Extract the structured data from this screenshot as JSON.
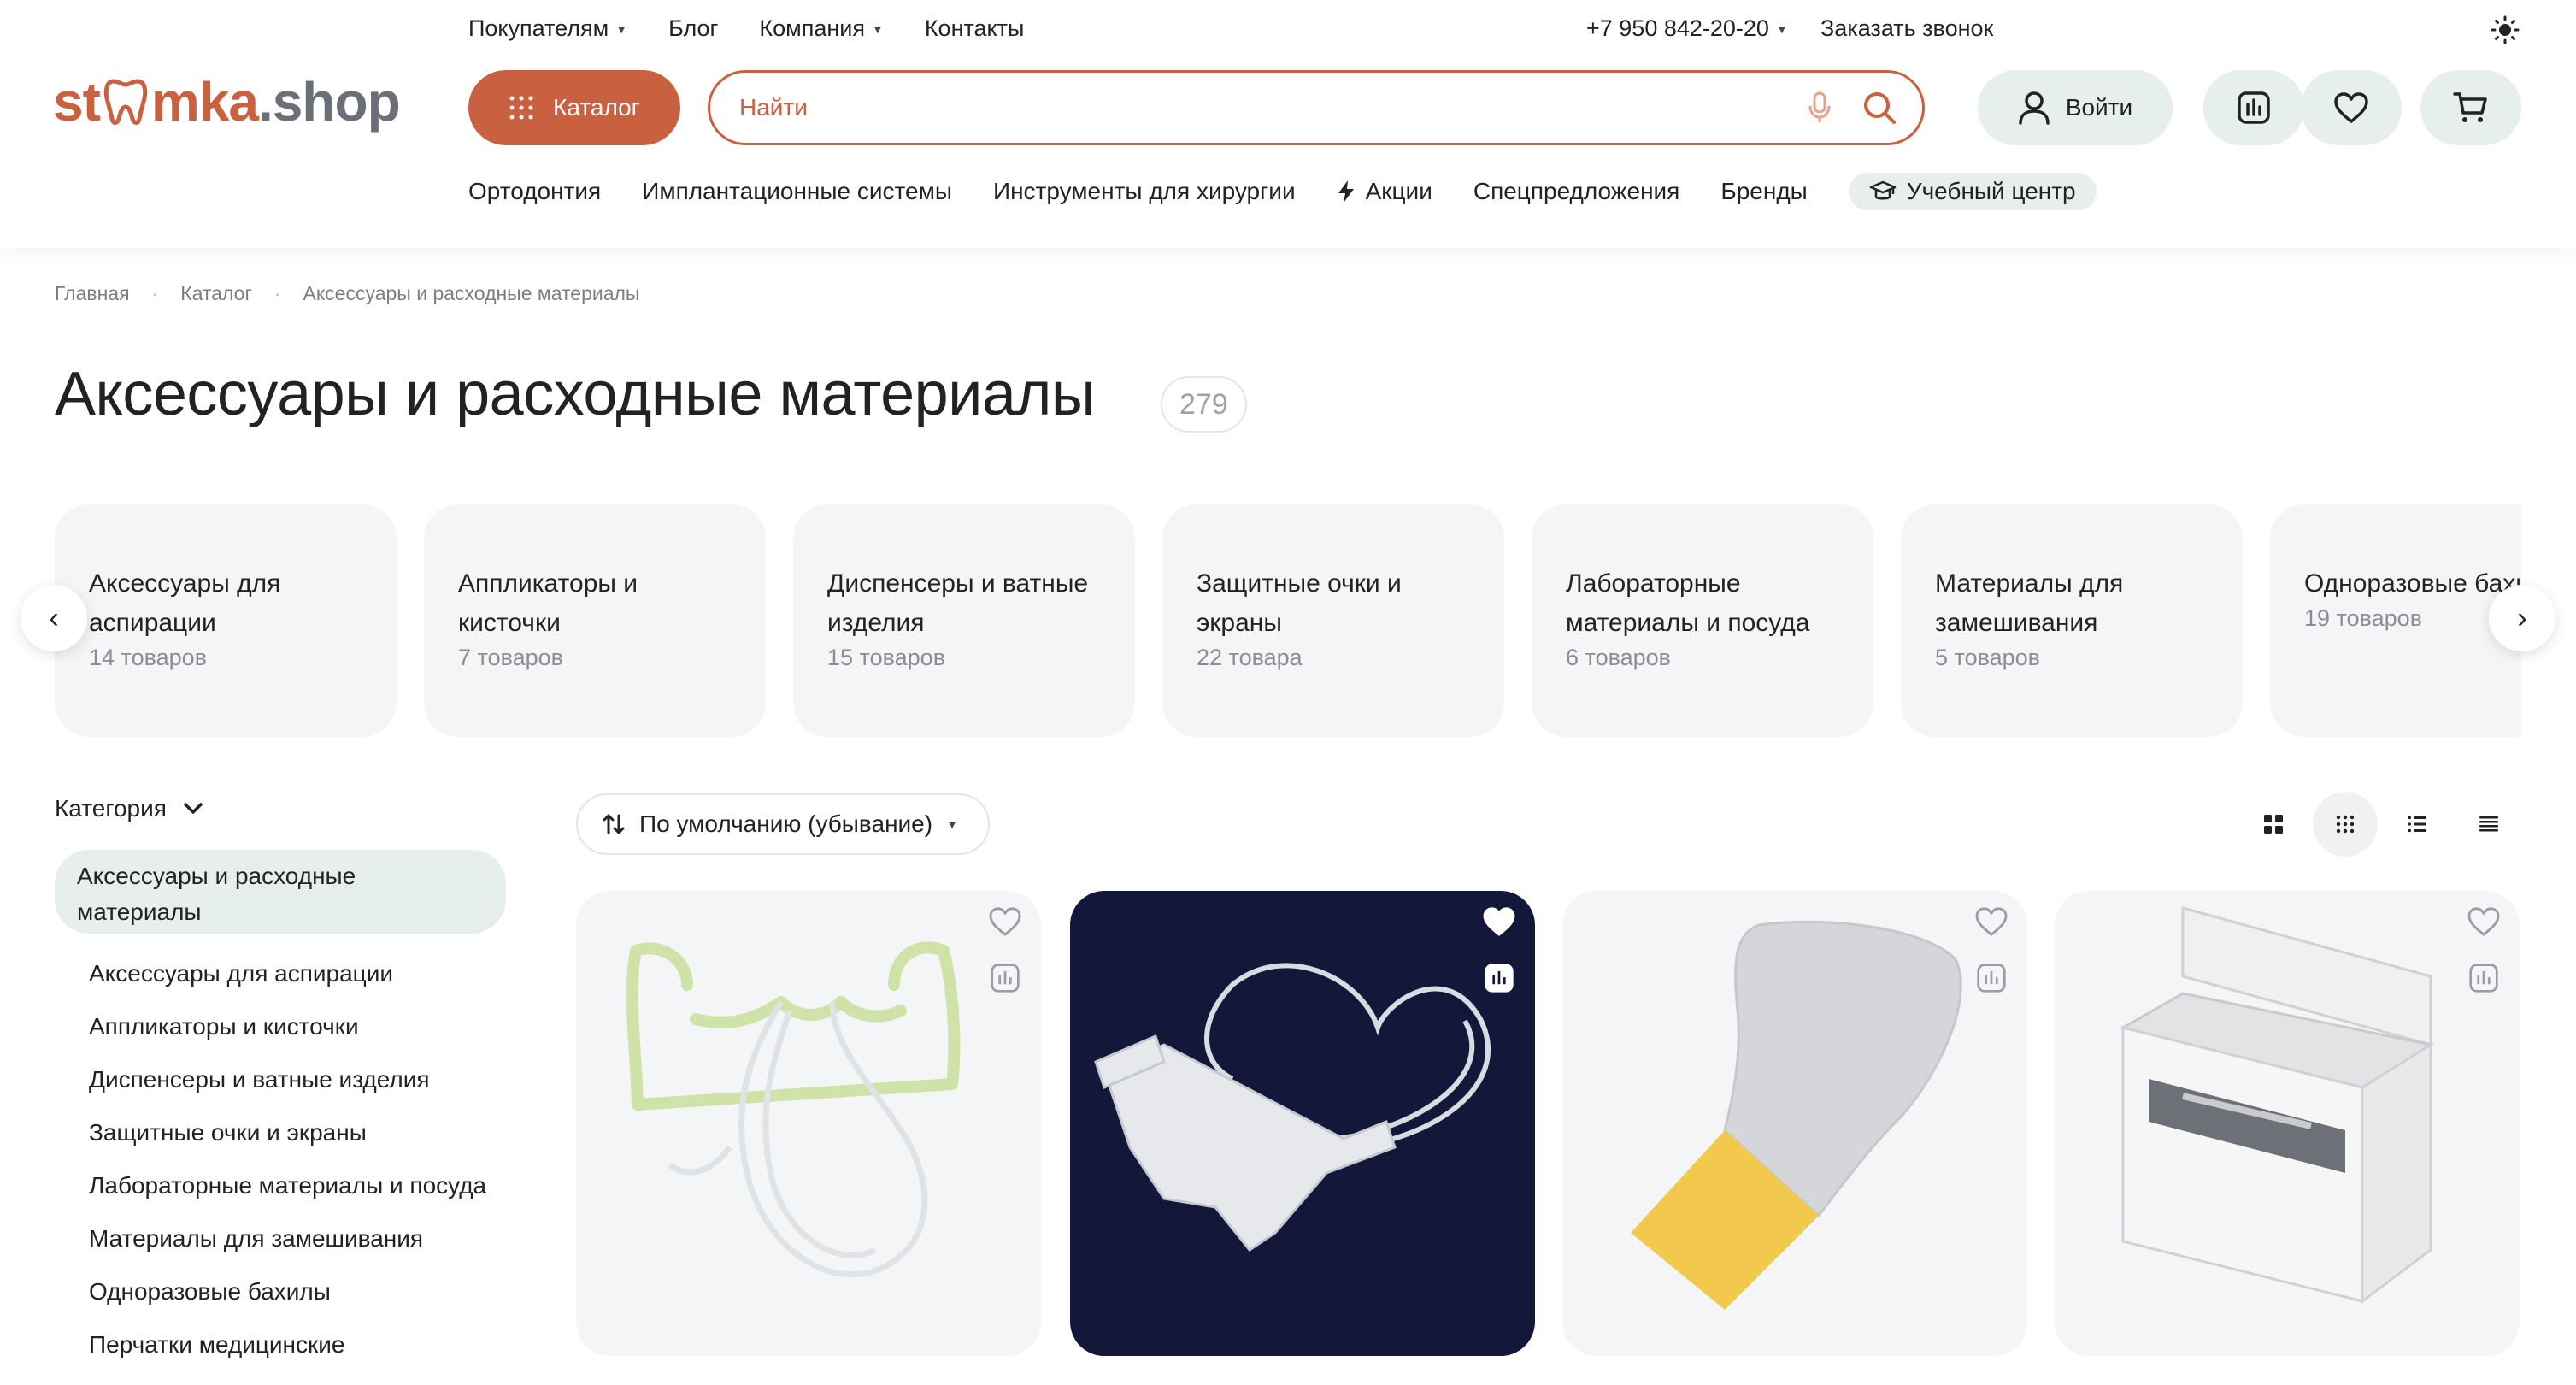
{
  "header": {
    "top_nav": [
      "Покупателям",
      "Блог",
      "Компания",
      "Контакты"
    ],
    "phone": "+7 950 842-20-20",
    "callback": "Заказать звонок",
    "logo_left": "st",
    "logo_mid": "mka",
    "logo_right": ".shop",
    "catalog_label": "Каталог",
    "search_placeholder": "Найти",
    "login_label": "Войти",
    "sub_nav": [
      "Ортодонтия",
      "Имплантационные системы",
      "Инструменты для хирургии",
      "Акции",
      "Спецпредложения",
      "Бренды"
    ],
    "training_center": "Учебный центр",
    "icons": [
      "theme-sun-icon",
      "grid-dots-icon",
      "microphone-icon",
      "search-icon",
      "user-icon",
      "compare-chart-icon",
      "heart-icon",
      "cart-icon",
      "lightning-icon",
      "graduation-cap-icon"
    ]
  },
  "breadcrumb": [
    "Главная",
    "Каталог",
    "Аксессуары и расходные материалы"
  ],
  "page": {
    "title": "Аксессуары и расходные материалы",
    "count": "279"
  },
  "categories": [
    {
      "name": "Аксессуары для аспирации",
      "count": "14 товаров"
    },
    {
      "name": "Аппликаторы и кисточки",
      "count": "7 товаров"
    },
    {
      "name": "Диспенсеры и ватные изделия",
      "count": "15 товаров"
    },
    {
      "name": "Защитные очки и экраны",
      "count": "22 товара"
    },
    {
      "name": "Лабораторные материалы и посуда",
      "count": "6 товаров"
    },
    {
      "name": "Материалы для замешивания",
      "count": "5 товаров"
    },
    {
      "name": "Одноразовые бахилы",
      "count": "19 товаров"
    }
  ],
  "sidebar": {
    "heading": "Категория",
    "active": "Аксессуары и расходные материалы",
    "items": [
      "Аксессуары для аспирации",
      "Аппликаторы и кисточки",
      "Диспенсеры и ватные изделия",
      "Защитные очки и экраны",
      "Лабораторные материалы и посуда",
      "Материалы для замешивания",
      "Одноразовые бахилы",
      "Перчатки медицинские"
    ]
  },
  "toolbar": {
    "sort_label": "По умолчанию (убывание)",
    "views": [
      "grid-large-icon",
      "grid-small-icon",
      "list-icon",
      "table-icon"
    ],
    "active_view": 1
  },
  "colors": {
    "accent": "#c9603f",
    "accent_soft": "#e6efea",
    "card_bg": "#f4f5f7"
  }
}
